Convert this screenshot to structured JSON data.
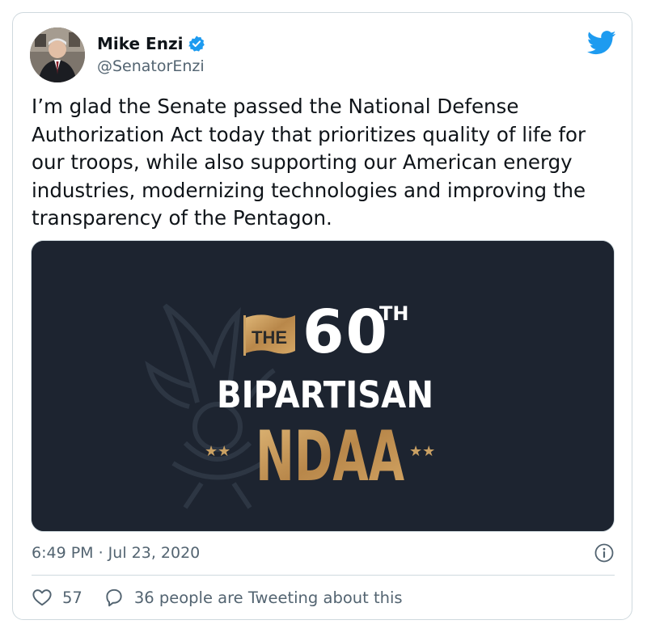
{
  "tweet": {
    "author_name": "Mike Enzi",
    "author_handle": "@SenatorEnzi",
    "text": "I’m glad the Senate passed the National Defense Authorization Act today that prioritizes quality of life for our troops, while also supporting our American energy industries, modernizing technologies and improving the transparency of the Pentagon.",
    "timestamp": "6:49 PM · Jul 23, 2020",
    "like_count": "57",
    "tweeting_about": "36 people are Tweeting about this"
  },
  "media": {
    "line1_prefix": "THE",
    "line1_number": "60",
    "line1_suffix": "TH",
    "line2": "BIPARTISAN",
    "line3": "NDAA",
    "stars_left": "★★",
    "stars_right": "★★"
  },
  "icons": {
    "verified": "verified-badge-icon",
    "bird": "twitter-bird-icon",
    "info": "info-icon",
    "like": "heart-icon",
    "reply": "speech-bubble-icon"
  },
  "colors": {
    "verified": "#1d9bf0",
    "bird": "#1d9bf0",
    "media_bg": "#1d2430",
    "gold": "#c9a063"
  }
}
